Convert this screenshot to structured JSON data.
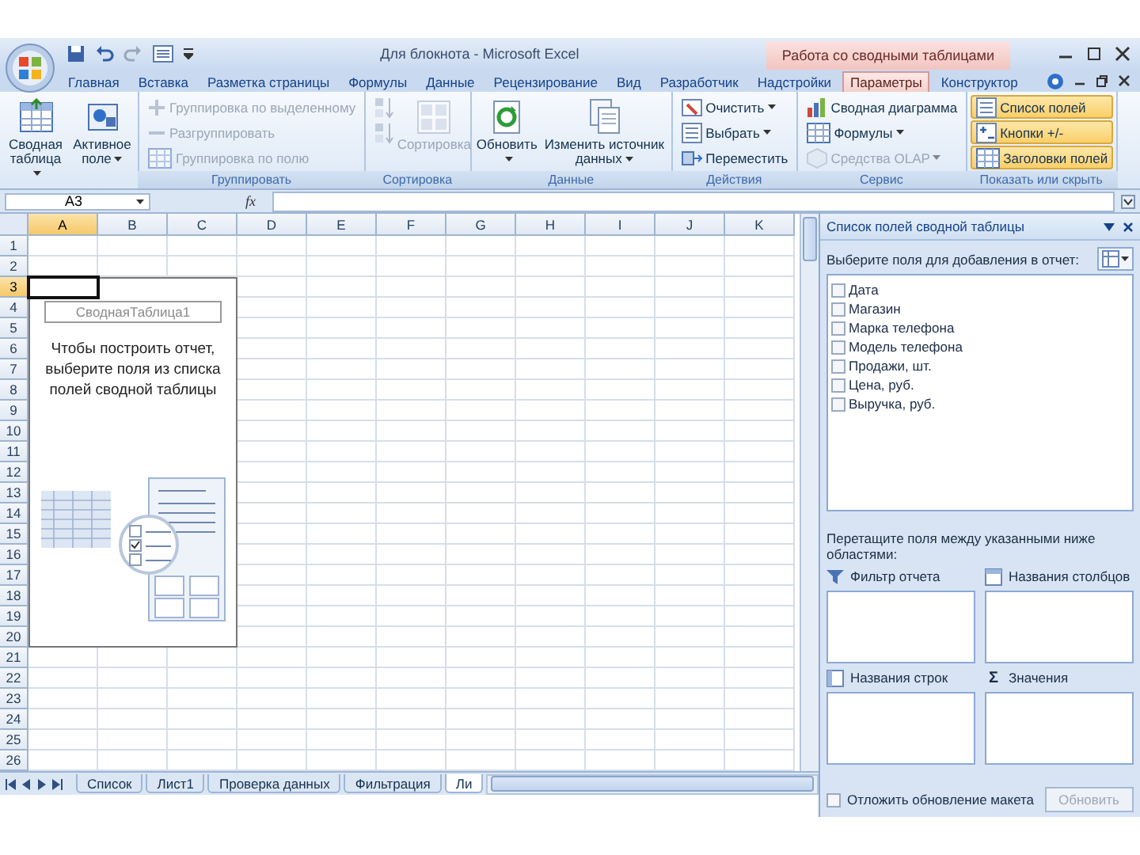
{
  "window": {
    "title": "Для блокнота - Microsoft Excel",
    "context_tab": "Работа со сводными таблицами"
  },
  "ribbon_tabs": [
    {
      "label": "Главная",
      "selected": false
    },
    {
      "label": "Вставка",
      "selected": false
    },
    {
      "label": "Разметка страницы",
      "selected": false
    },
    {
      "label": "Формулы",
      "selected": false
    },
    {
      "label": "Данные",
      "selected": false
    },
    {
      "label": "Рецензирование",
      "selected": false
    },
    {
      "label": "Вид",
      "selected": false
    },
    {
      "label": "Разработчик",
      "selected": false
    },
    {
      "label": "Надстройки",
      "selected": false
    },
    {
      "label": "Параметры",
      "selected": true
    },
    {
      "label": "Конструктор",
      "selected": false
    }
  ],
  "ribbon_groups": [
    {
      "items": [
        {
          "kind": "large",
          "label": "Сводная таблица",
          "dropdown": true,
          "disabled": false
        },
        {
          "kind": "large",
          "label": "Активное поле",
          "dropdown": true,
          "disabled": false
        }
      ]
    },
    {
      "label": "Группировать",
      "items": [
        {
          "kind": "small",
          "label": "Группировка по выделенному",
          "dropdown": false,
          "disabled": true
        },
        {
          "kind": "small",
          "label": "Разгруппировать",
          "dropdown": false,
          "disabled": true
        },
        {
          "kind": "small",
          "label": "Группировка по полю",
          "dropdown": false,
          "disabled": true
        }
      ]
    },
    {
      "label": "Сортировка",
      "items": [
        {
          "kind": "icon",
          "disabled": true
        },
        {
          "kind": "icon",
          "disabled": true
        },
        {
          "kind": "large",
          "label": "Сортировка",
          "dropdown": false,
          "disabled": true
        }
      ]
    },
    {
      "label": "Данные",
      "items": [
        {
          "kind": "large",
          "label": "Обновить",
          "dropdown": true,
          "disabled": false
        },
        {
          "kind": "large",
          "label": "Изменить источник данных",
          "dropdown": true,
          "disabled": false
        }
      ]
    },
    {
      "label": "Действия",
      "items": [
        {
          "kind": "small",
          "label": "Очистить",
          "dropdown": true,
          "disabled": false
        },
        {
          "kind": "small",
          "label": "Выбрать",
          "dropdown": true,
          "disabled": false
        },
        {
          "kind": "small",
          "label": "Переместить",
          "dropdown": false,
          "disabled": false
        }
      ]
    },
    {
      "label": "Сервис",
      "items": [
        {
          "kind": "small",
          "label": "Сводная диаграмма",
          "dropdown": false,
          "disabled": false
        },
        {
          "kind": "small",
          "label": "Формулы",
          "dropdown": true,
          "disabled": false
        },
        {
          "kind": "small",
          "label": "Средства OLAP",
          "dropdown": true,
          "disabled": true
        }
      ]
    },
    {
      "label": "Показать или скрыть",
      "items": [
        {
          "kind": "small",
          "label": "Список полей",
          "dropdown": false,
          "disabled": false,
          "on": true
        },
        {
          "kind": "small",
          "label": "Кнопки +/-",
          "dropdown": false,
          "disabled": false,
          "on": true
        },
        {
          "kind": "small",
          "label": "Заголовки полей",
          "dropdown": false,
          "disabled": false,
          "on": true
        }
      ]
    }
  ],
  "formula_bar": {
    "name_box": "A3",
    "function_button": "fx"
  },
  "sheet": {
    "columns": [
      {
        "label": "A",
        "selected": true
      },
      {
        "label": "B",
        "selected": false
      },
      {
        "label": "C",
        "selected": false
      },
      {
        "label": "D",
        "selected": false
      },
      {
        "label": "E",
        "selected": false
      },
      {
        "label": "F",
        "selected": false
      },
      {
        "label": "G",
        "selected": false
      },
      {
        "label": "H",
        "selected": false
      },
      {
        "label": "I",
        "selected": false
      },
      {
        "label": "J",
        "selected": false
      },
      {
        "label": "K",
        "selected": false
      }
    ],
    "rows": [
      {
        "label": "1",
        "selected": false
      },
      {
        "label": "2",
        "selected": false
      },
      {
        "label": "3",
        "selected": true
      },
      {
        "label": "4",
        "selected": false
      },
      {
        "label": "5",
        "selected": false
      },
      {
        "label": "6",
        "selected": false
      },
      {
        "label": "7",
        "selected": false
      },
      {
        "label": "8",
        "selected": false
      },
      {
        "label": "9",
        "selected": false
      },
      {
        "label": "10",
        "selected": false
      },
      {
        "label": "11",
        "selected": false
      },
      {
        "label": "12",
        "selected": false
      },
      {
        "label": "13",
        "selected": false
      },
      {
        "label": "14",
        "selected": false
      },
      {
        "label": "15",
        "selected": false
      },
      {
        "label": "16",
        "selected": false
      },
      {
        "label": "17",
        "selected": false
      },
      {
        "label": "18",
        "selected": false
      },
      {
        "label": "19",
        "selected": false
      },
      {
        "label": "20",
        "selected": false
      },
      {
        "label": "21",
        "selected": false
      },
      {
        "label": "22",
        "selected": false
      },
      {
        "label": "23",
        "selected": false
      },
      {
        "label": "24",
        "selected": false
      },
      {
        "label": "25",
        "selected": false
      },
      {
        "label": "26",
        "selected": false
      }
    ],
    "pivot_placeholder": {
      "name": "СводнаяТаблица1",
      "hint": "Чтобы построить отчет, выберите поля из списка полей сводной таблицы"
    },
    "sheet_tabs": [
      {
        "label": "Список",
        "selected": false
      },
      {
        "label": "Лист1",
        "selected": false
      },
      {
        "label": "Проверка данных",
        "selected": false
      },
      {
        "label": "Фильтрация",
        "selected": false
      },
      {
        "label": "Ли",
        "selected": true
      }
    ]
  },
  "field_list": {
    "title": "Список полей сводной таблицы",
    "choose_label": "Выберите поля для добавления в отчет:",
    "fields": [
      {
        "label": "Дата",
        "checked": false
      },
      {
        "label": "Магазин",
        "checked": false
      },
      {
        "label": "Марка телефона",
        "checked": false
      },
      {
        "label": "Модель телефона",
        "checked": false
      },
      {
        "label": "Продажи, шт.",
        "checked": false
      },
      {
        "label": "Цена, руб.",
        "checked": false
      },
      {
        "label": "Выручка, руб.",
        "checked": false
      }
    ],
    "areas_hint": "Перетащите поля между указанными ниже областями:",
    "areas": [
      {
        "label": "Фильтр отчета"
      },
      {
        "label": "Названия столбцов"
      },
      {
        "label": "Названия строк"
      },
      {
        "label": "Значения",
        "symbol": "Σ"
      }
    ],
    "defer": {
      "label": "Отложить обновление макета",
      "checked": false
    },
    "update_button": {
      "label": "Обновить",
      "disabled": true
    }
  }
}
